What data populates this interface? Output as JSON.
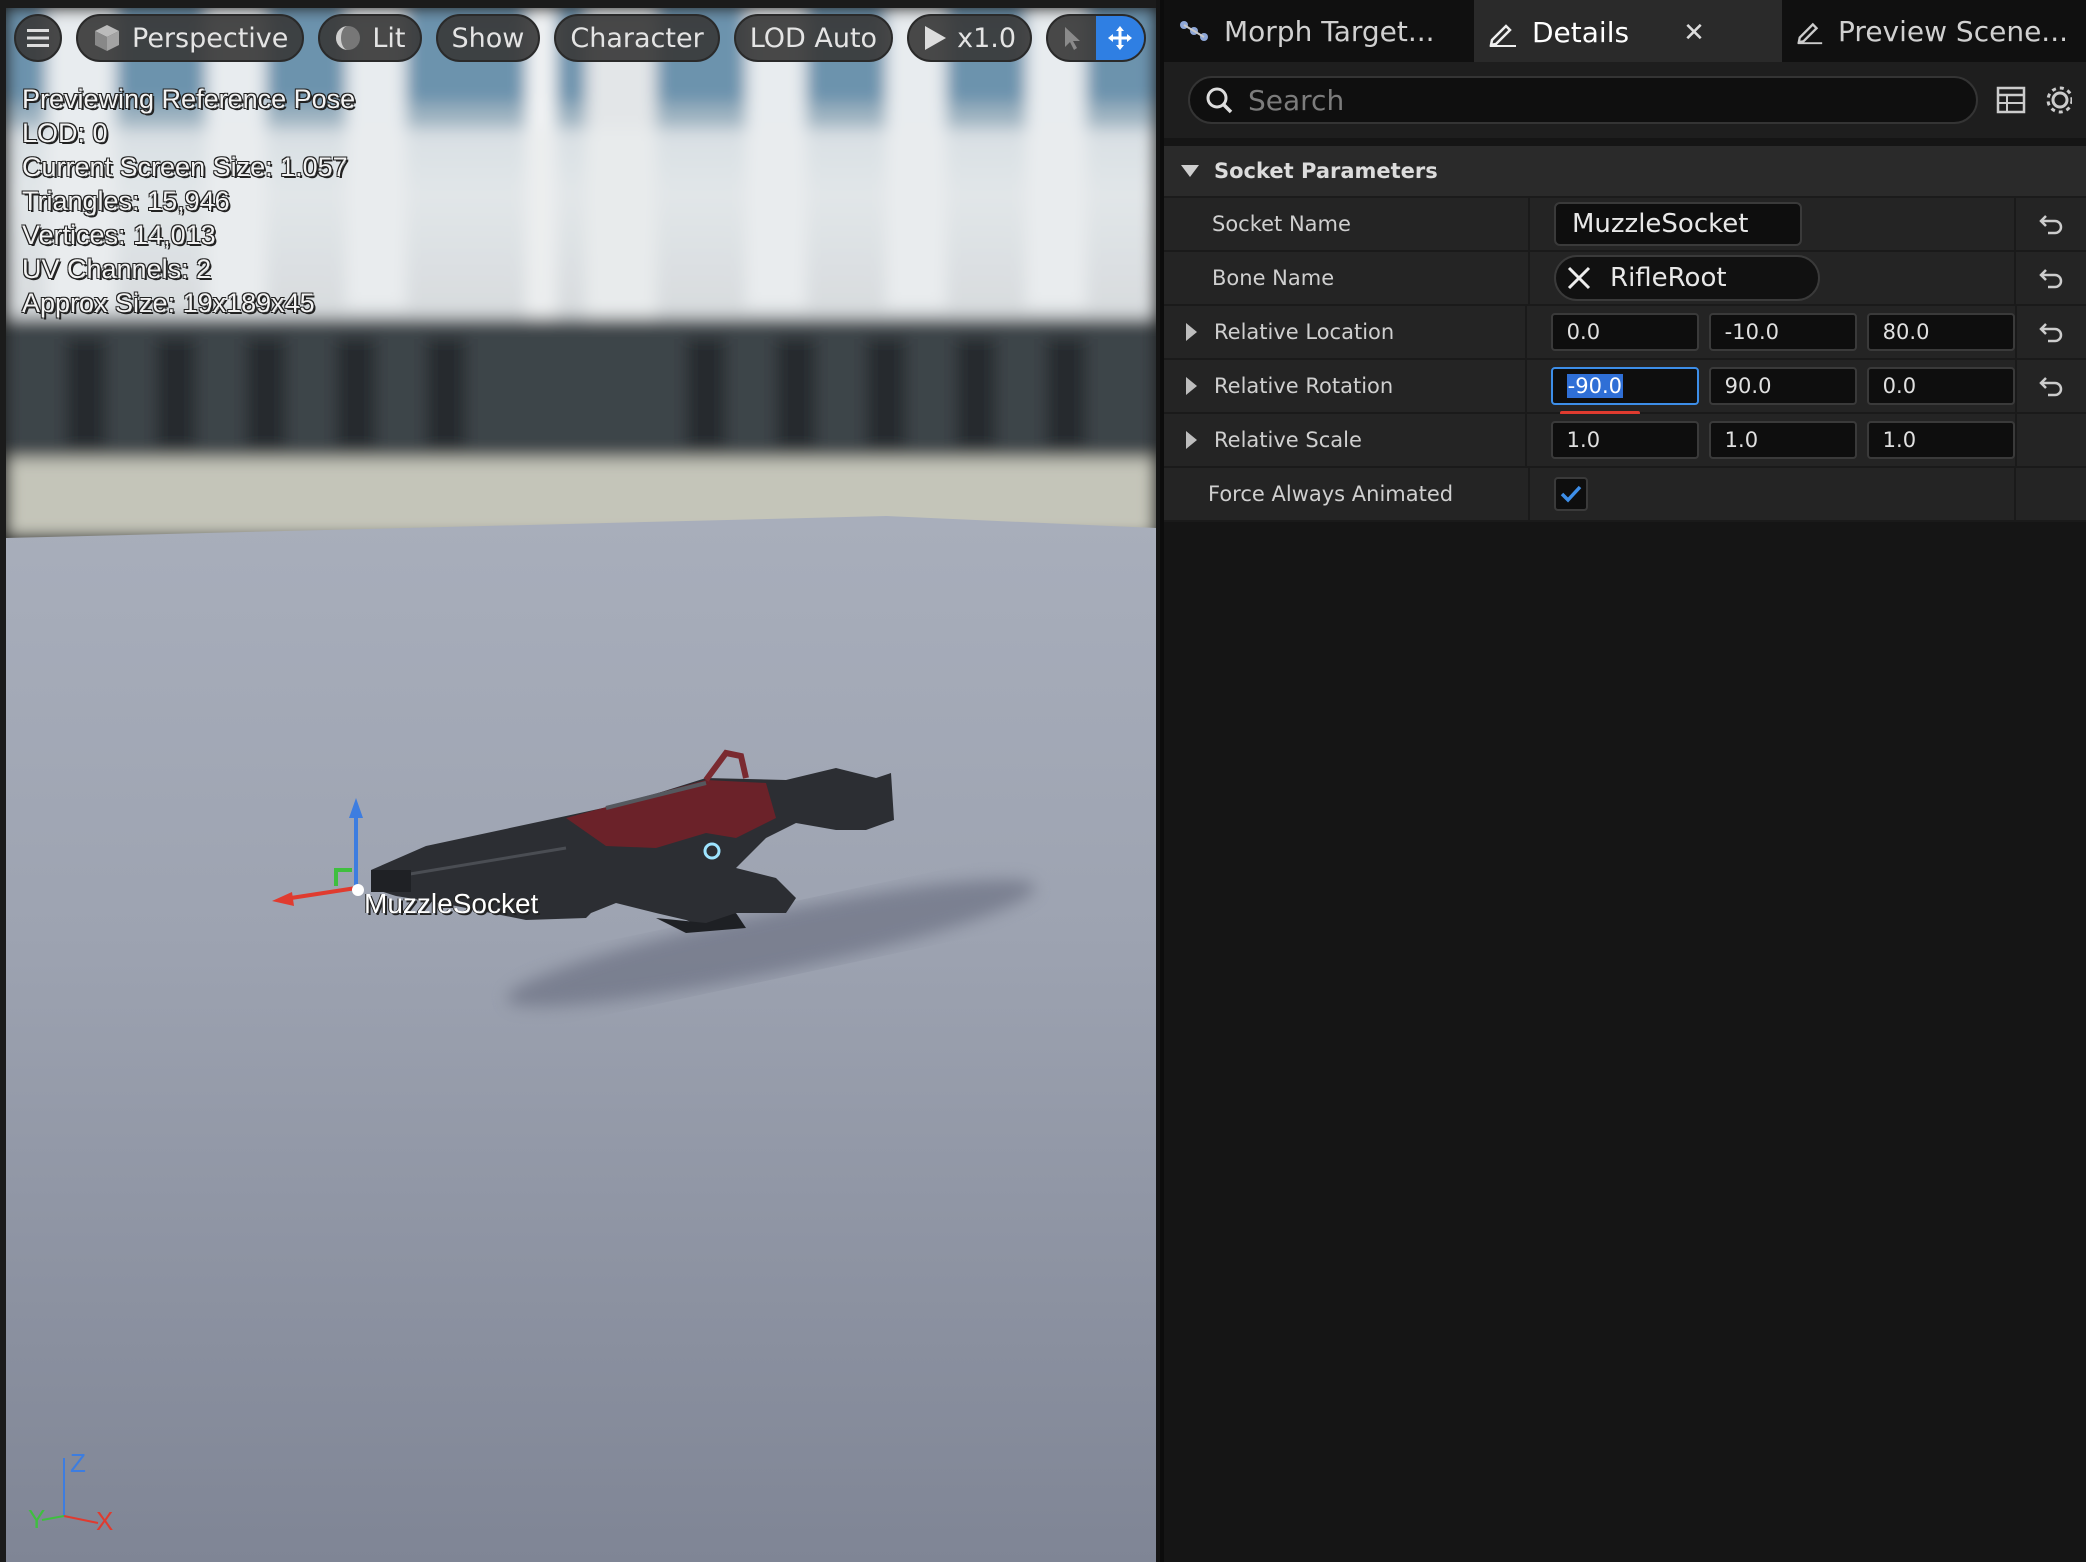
{
  "toolbar": {
    "menu_icon": "hamburger-icon",
    "perspective_label": "Perspective",
    "lit_label": "Lit",
    "show_label": "Show",
    "character_label": "Character",
    "lod_label": "LOD Auto",
    "play_rate_label": "x1.0"
  },
  "stats": {
    "line1": "Previewing Reference Pose",
    "line2": "LOD: 0",
    "line3": "Current Screen Size: 1.057",
    "line4": "Triangles: 15,946",
    "line5": "Vertices: 14,013",
    "line6": "UV Channels: 2",
    "line7": "Approx Size: 19x189x45"
  },
  "viewport": {
    "socket_label": "MuzzleSocket",
    "axis_z": "Z",
    "axis_y": "Y",
    "axis_x": "X"
  },
  "tabs": {
    "morph_targets": "Morph Target...",
    "details": "Details",
    "preview_scene": "Preview Scene..."
  },
  "search": {
    "placeholder": "Search"
  },
  "details": {
    "category": "Socket Parameters",
    "socket_name_label": "Socket Name",
    "socket_name_value": "MuzzleSocket",
    "bone_name_label": "Bone Name",
    "bone_name_value": "RifleRoot",
    "location_label": "Relative Location",
    "location": {
      "x": "0.0",
      "y": "-10.0",
      "z": "80.0"
    },
    "rotation_label": "Relative Rotation",
    "rotation": {
      "x": "-90.0",
      "y": "90.0",
      "z": "0.0"
    },
    "scale_label": "Relative Scale",
    "scale": {
      "x": "1.0",
      "y": "1.0",
      "z": "1.0"
    },
    "force_animated_label": "Force Always Animated",
    "force_animated_checked": true
  },
  "colors": {
    "accent": "#2f7fe3",
    "axis_x": "#e03b2f",
    "axis_y": "#3fbf3f",
    "axis_z": "#3d7de0"
  }
}
